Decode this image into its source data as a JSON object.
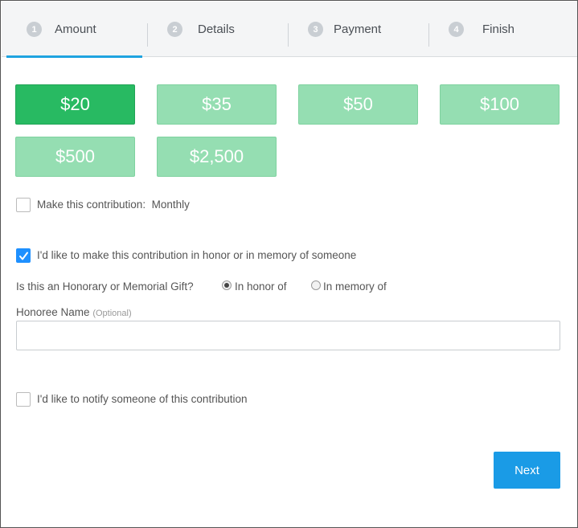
{
  "steps": [
    {
      "num": "1",
      "label": "Amount"
    },
    {
      "num": "2",
      "label": "Details"
    },
    {
      "num": "3",
      "label": "Payment"
    },
    {
      "num": "4",
      "label": "Finish"
    }
  ],
  "amounts": [
    "$20",
    "$35",
    "$50",
    "$100",
    "$500",
    "$2,500"
  ],
  "selected_amount": "$20",
  "recurring": {
    "label": "Make this contribution:",
    "value": "Monthly",
    "checked": false
  },
  "tribute": {
    "label": "I'd like to make this contribution in honor or in memory of someone",
    "checked": true
  },
  "gift_type": {
    "question": "Is this an Honorary or Memorial Gift?",
    "options": [
      "In honor of",
      "In memory of"
    ],
    "selected": "In honor of"
  },
  "honoree": {
    "label": "Honoree Name",
    "optional": "(Optional)",
    "value": ""
  },
  "notify": {
    "label": "I'd like to notify someone of this contribution",
    "checked": false
  },
  "next_label": "Next",
  "colors": {
    "selected_amount_bg": "#28ba62",
    "amount_bg": "#95deb2",
    "accent_blue": "#1a9be6",
    "checkbox_checked": "#1e90ff"
  }
}
